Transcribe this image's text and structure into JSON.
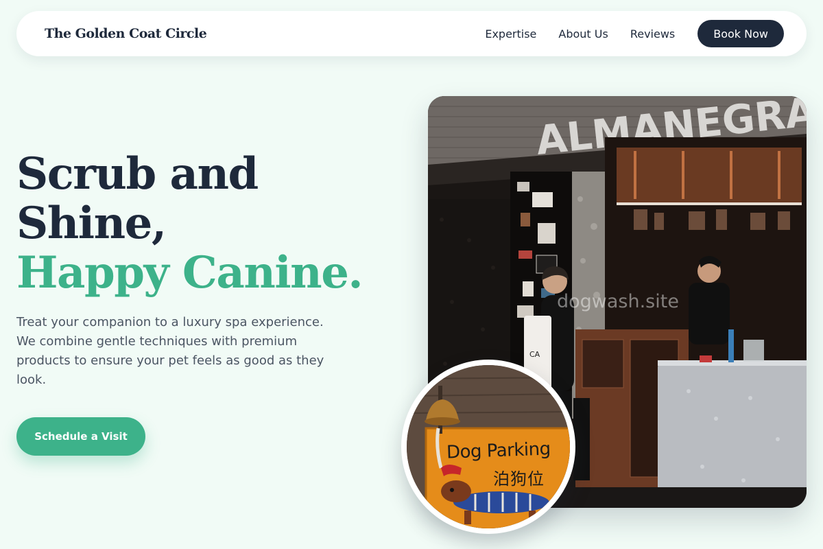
{
  "brand": {
    "name": "The Golden Coat Circle"
  },
  "nav": {
    "links": [
      {
        "label": "Expertise"
      },
      {
        "label": "About Us"
      },
      {
        "label": "Reviews"
      }
    ],
    "cta_label": "Book Now"
  },
  "hero": {
    "title_line1": "Scrub and",
    "title_line2": "Shine,",
    "title_accent": "Happy Canine.",
    "description": "Treat your companion to a luxury spa experience. We combine gentle techniques with premium products to ensure your pet feels as good as they look.",
    "cta_label": "Schedule a Visit"
  },
  "photo": {
    "storefront_sign": "ALMANEGRA",
    "watermark": "dogwash.site"
  },
  "badge": {
    "sign_text": "Dog Parking",
    "sign_text_cn": "泊狗位"
  },
  "colors": {
    "background": "#f1fbf6",
    "primary_dark": "#1e293b",
    "accent_green": "#3db28a",
    "body_text": "#4b5563"
  }
}
